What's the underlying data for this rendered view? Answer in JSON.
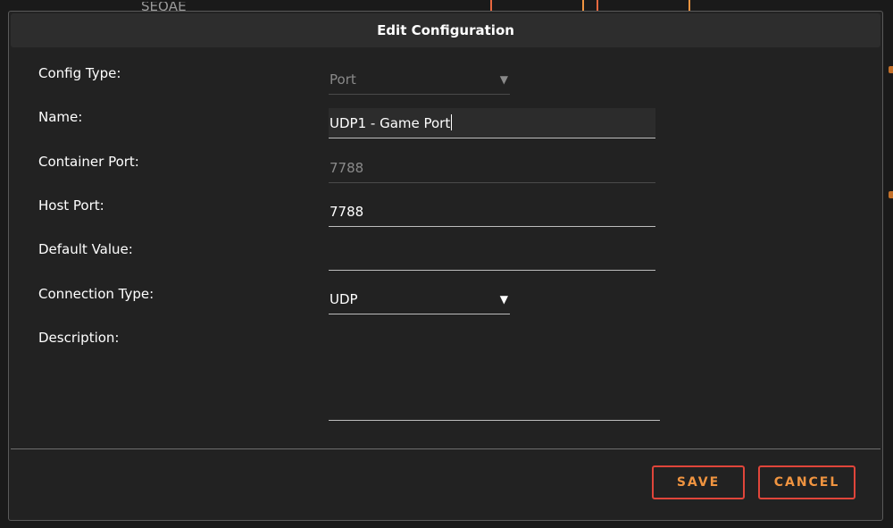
{
  "background": {
    "peek_text": "SEQAE",
    "accent_colors": [
      "#e9683f",
      "#f09440"
    ]
  },
  "dialog": {
    "title": "Edit Configuration",
    "fields": {
      "config_type": {
        "label": "Config Type:",
        "value": "Port",
        "disabled": true
      },
      "name": {
        "label": "Name:",
        "value": "UDP1 - Game Port",
        "focused": true
      },
      "container_port": {
        "label": "Container Port:",
        "value": "7788",
        "disabled": true
      },
      "host_port": {
        "label": "Host Port:",
        "value": "7788"
      },
      "default_value": {
        "label": "Default Value:",
        "value": ""
      },
      "connection_type": {
        "label": "Connection Type:",
        "value": "UDP"
      },
      "description": {
        "label": "Description:",
        "value": ""
      }
    },
    "icons": {
      "dropdown": "caret-down-icon"
    },
    "buttons": {
      "save": "SAVE",
      "cancel": "CANCEL"
    },
    "colors": {
      "button_border": "#e0453a",
      "button_text": "#f09440",
      "dialog_bg": "#222222",
      "header_bg": "#2d2d2d"
    }
  }
}
